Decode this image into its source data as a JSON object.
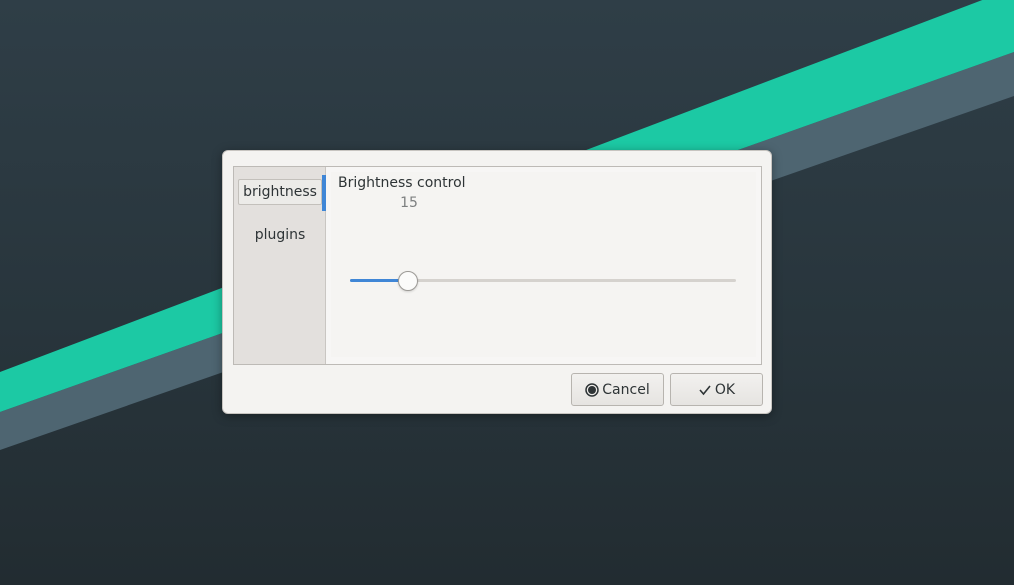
{
  "dialog": {
    "tabs": [
      {
        "label": "brightness",
        "active": true
      },
      {
        "label": "plugins",
        "active": false
      }
    ],
    "content": {
      "title": "Brightness control",
      "value_label": "15",
      "slider": {
        "value_fraction": 0.15
      }
    },
    "buttons": {
      "cancel_label": "Cancel",
      "ok_label": "OK",
      "cancel_icon": "cancel-icon",
      "ok_icon": "checkmark-icon"
    }
  },
  "colors": {
    "accent": "#3f86d6",
    "wallpaper_teal": "#1cc9a4",
    "wallpaper_slate": "#4e6571"
  }
}
